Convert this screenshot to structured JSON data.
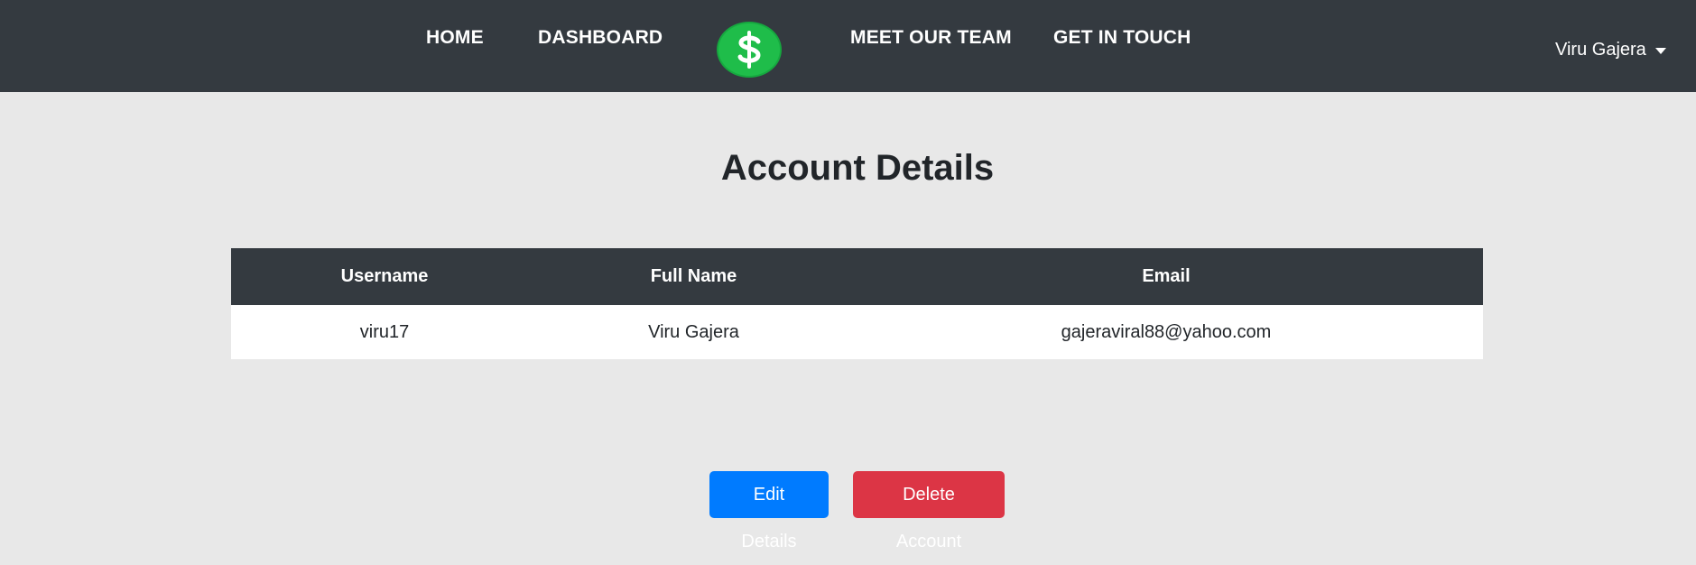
{
  "nav": {
    "home": "HOME",
    "dashboard": "DASHBOARD",
    "team": "MEET OUR TEAM",
    "contact": "GET IN TOUCH",
    "logo_icon": "dollar-sign-icon",
    "user_name": "Viru Gajera"
  },
  "page": {
    "title": "Account Details"
  },
  "table": {
    "headers": [
      "Username",
      "Full Name",
      "Email"
    ],
    "rows": [
      [
        "viru17",
        "Viru Gajera",
        "gajeraviral88@yahoo.com"
      ]
    ]
  },
  "actions": {
    "edit_label": "Edit Details",
    "delete_label": "Delete Account"
  },
  "colors": {
    "navbar": "#343a40",
    "logo": "#1fbd4a",
    "primary": "#007bff",
    "danger": "#dc3545",
    "background": "#e8e8e8"
  }
}
